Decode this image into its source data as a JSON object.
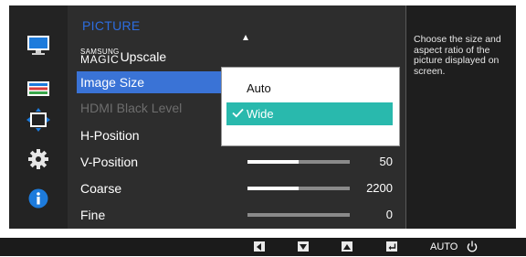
{
  "menu": {
    "title": "PICTURE",
    "brand_small": "SAMSUNG",
    "brand_large": "MAGIC",
    "items": [
      {
        "label": "Upscale"
      },
      {
        "label": "Image Size"
      },
      {
        "label": "HDMI Black Level"
      },
      {
        "label": "H-Position"
      },
      {
        "label": "V-Position",
        "value": "50",
        "level": 0.5
      },
      {
        "label": "Coarse",
        "value": "2200",
        "level": 0.5
      },
      {
        "label": "Fine",
        "value": "0",
        "level": 0
      }
    ]
  },
  "popup": {
    "options": [
      {
        "label": "Auto",
        "selected": false
      },
      {
        "label": "Wide",
        "selected": true
      }
    ]
  },
  "info": {
    "description": "Choose the size and aspect ratio of the picture displayed on screen."
  },
  "sidebar": {
    "icons": [
      "monitor-icon",
      "color-settings-icon",
      "size-position-icon",
      "gear-icon",
      "info-icon"
    ]
  },
  "bottom_bar": {
    "auto_label": "AUTO"
  },
  "colors": {
    "title_blue": "#2d6de0",
    "selection_blue": "#3a73d6",
    "popup_teal": "#29b9ad"
  }
}
